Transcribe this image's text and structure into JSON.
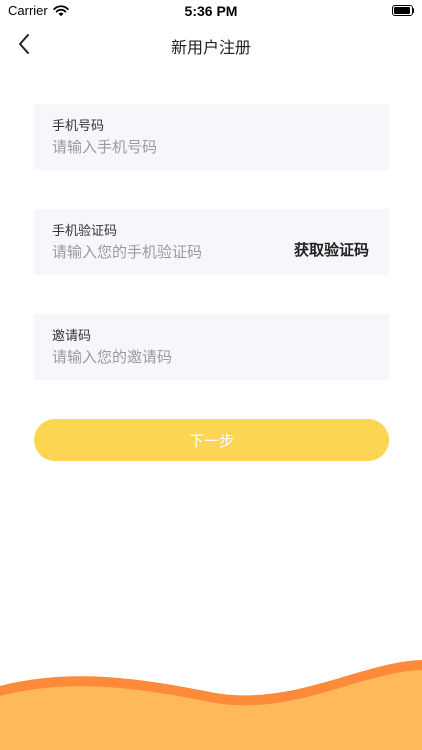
{
  "status_bar": {
    "carrier": "Carrier",
    "time": "5:36 PM",
    "wifi_icon": "wifi-icon",
    "battery_icon": "battery-icon"
  },
  "nav": {
    "back_icon": "chevron-left-icon",
    "title": "新用户注册"
  },
  "form": {
    "phone": {
      "label": "手机号码",
      "placeholder": "请输入手机号码",
      "value": ""
    },
    "code": {
      "label": "手机验证码",
      "placeholder": "请输入您的手机验证码",
      "value": "",
      "action_label": "获取验证码"
    },
    "invite": {
      "label": "邀请码",
      "placeholder": "请输入您的邀请码",
      "value": ""
    },
    "next_label": "下一步"
  },
  "colors": {
    "accent": "#fcd553",
    "wave_dark": "#ff8a3a",
    "wave_light": "#ffb95a",
    "field_bg": "#f7f6fa"
  }
}
